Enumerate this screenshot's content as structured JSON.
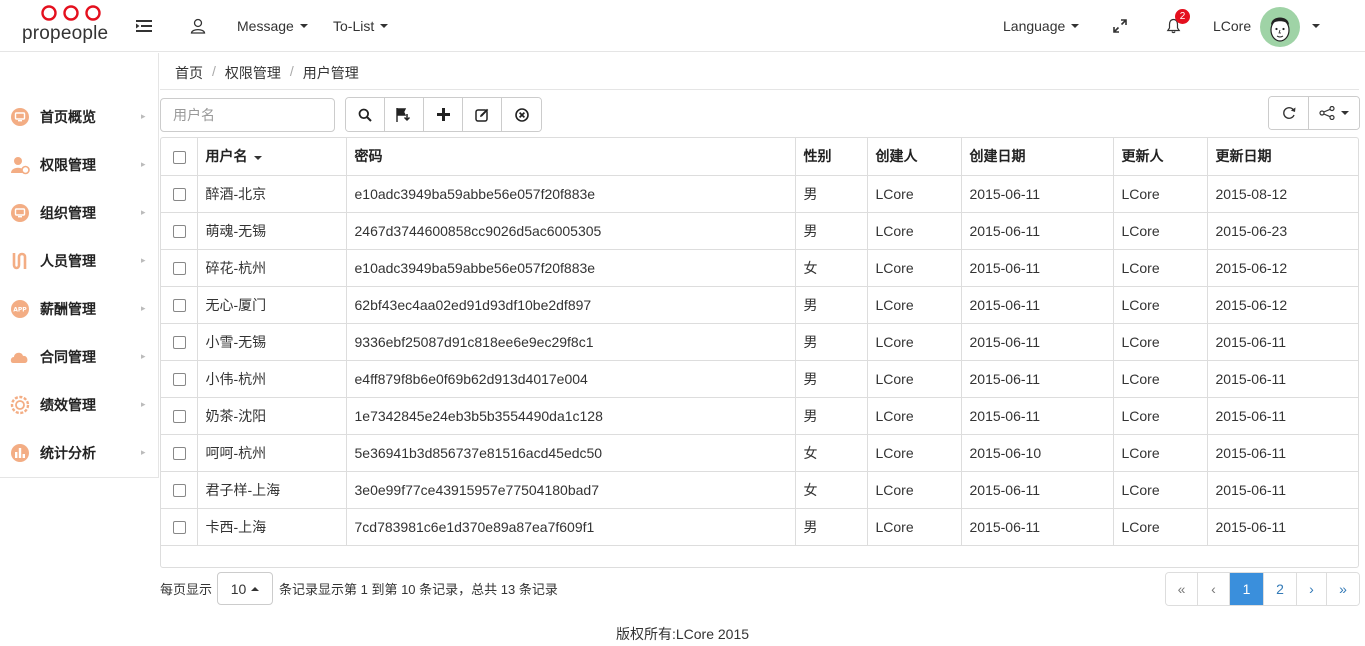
{
  "brand": {
    "name": "propeople",
    "accent": "#e4101e"
  },
  "header": {
    "menu_toggle_icon": "menu-indent-icon",
    "user_icon": "user-icon",
    "message": "Message",
    "todo": "To-List",
    "language": "Language",
    "fullscreen_icon": "expand-icon",
    "bell_icon": "bell-icon",
    "notification_count": "2",
    "username": "LCore"
  },
  "sidebar": {
    "items": [
      {
        "label": "首页概览",
        "icon": "monitor-icon"
      },
      {
        "label": "权限管理",
        "icon": "user-settings-icon"
      },
      {
        "label": "组织管理",
        "icon": "monitor-icon"
      },
      {
        "label": "人员管理",
        "icon": "route-icon"
      },
      {
        "label": "薪酬管理",
        "icon": "app-icon"
      },
      {
        "label": "合同管理",
        "icon": "cloud-icon"
      },
      {
        "label": "绩效管理",
        "icon": "gear-icon"
      },
      {
        "label": "统计分析",
        "icon": "bar-chart-icon"
      }
    ]
  },
  "breadcrumb": [
    "首页",
    "权限管理",
    "用户管理"
  ],
  "toolbar": {
    "search_placeholder": "用户名",
    "buttons": [
      "search-icon",
      "save-flag-icon",
      "plus-icon",
      "edit-icon",
      "delete-icon"
    ],
    "right_buttons": [
      "refresh-icon",
      "share-icon"
    ]
  },
  "table": {
    "headers": [
      "用户名",
      "密码",
      "性别",
      "创建人",
      "创建日期",
      "更新人",
      "更新日期"
    ],
    "rows": [
      [
        "醉酒-北京",
        "e10adc3949ba59abbe56e057f20f883e",
        "男",
        "LCore",
        "2015-06-11",
        "LCore",
        "2015-08-12"
      ],
      [
        "萌魂-无锡",
        "2467d3744600858cc9026d5ac6005305",
        "男",
        "LCore",
        "2015-06-11",
        "LCore",
        "2015-06-23"
      ],
      [
        "碎花-杭州",
        "e10adc3949ba59abbe56e057f20f883e",
        "女",
        "LCore",
        "2015-06-11",
        "LCore",
        "2015-06-12"
      ],
      [
        "无心-厦门",
        "62bf43ec4aa02ed91d93df10be2df897",
        "男",
        "LCore",
        "2015-06-11",
        "LCore",
        "2015-06-12"
      ],
      [
        "小雪-无锡",
        "9336ebf25087d91c818ee6e9ec29f8c1",
        "男",
        "LCore",
        "2015-06-11",
        "LCore",
        "2015-06-11"
      ],
      [
        "小伟-杭州",
        "e4ff879f8b6e0f69b62d913d4017e004",
        "男",
        "LCore",
        "2015-06-11",
        "LCore",
        "2015-06-11"
      ],
      [
        "奶茶-沈阳",
        "1e7342845e24eb3b5b3554490da1c128",
        "男",
        "LCore",
        "2015-06-11",
        "LCore",
        "2015-06-11"
      ],
      [
        "呵呵-杭州",
        "5e36941b3d856737e81516acd45edc50",
        "女",
        "LCore",
        "2015-06-10",
        "LCore",
        "2015-06-11"
      ],
      [
        "君子样-上海",
        "3e0e99f77ce43915957e77504180bad7",
        "女",
        "LCore",
        "2015-06-11",
        "LCore",
        "2015-06-11"
      ],
      [
        "卡西-上海",
        "7cd783981c6e1d370e89a87ea7f609f1",
        "男",
        "LCore",
        "2015-06-11",
        "LCore",
        "2015-06-11"
      ]
    ]
  },
  "pagination": {
    "per_page_label": "每页显示",
    "page_size": "10",
    "summary": "条记录显示第 1 到第 10 条记录，总共 13 条记录",
    "first": "«",
    "prev": "‹",
    "pages": [
      "1",
      "2"
    ],
    "next": "›",
    "last": "»",
    "current_page": "1"
  },
  "footer": {
    "copyright": "版权所有:LCore 2015"
  }
}
